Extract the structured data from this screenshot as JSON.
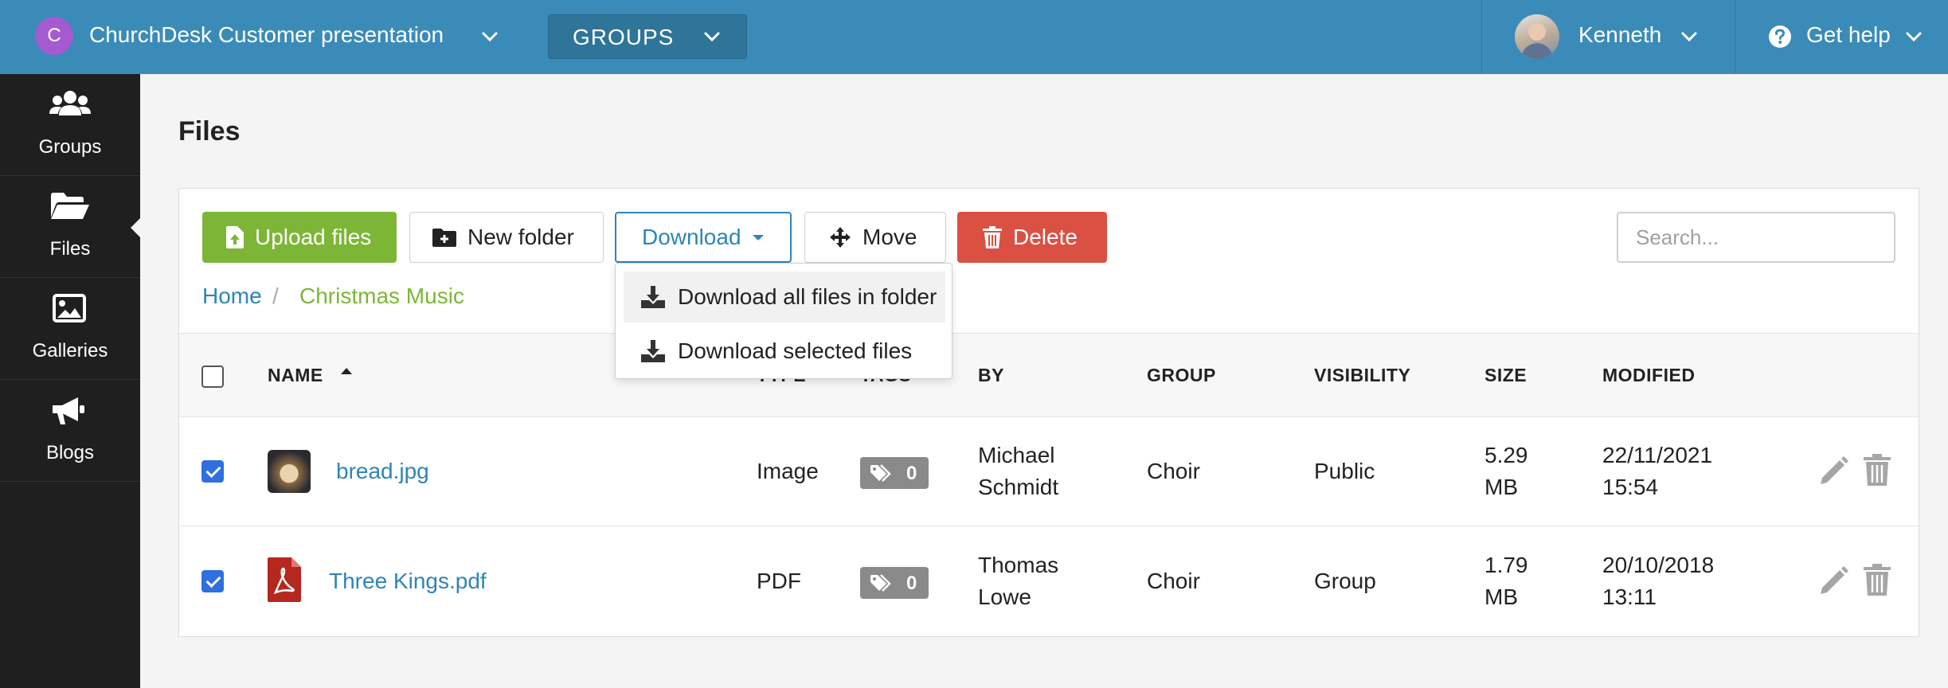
{
  "topbar": {
    "org_initial": "C",
    "org_name": "ChurchDesk Customer presentation",
    "groups_label": "GROUPS",
    "user_name": "Kenneth",
    "help_label": "Get help",
    "color": "#3b8bb8"
  },
  "sidebar": {
    "items": [
      {
        "label": "Groups",
        "icon": "users-icon"
      },
      {
        "label": "Files",
        "icon": "folder-open-icon"
      },
      {
        "label": "Galleries",
        "icon": "image-icon"
      },
      {
        "label": "Blogs",
        "icon": "megaphone-icon"
      }
    ],
    "active": "Files"
  },
  "page": {
    "title": "Files"
  },
  "toolbar": {
    "upload_label": "Upload files",
    "new_folder_label": "New folder",
    "download_label": "Download",
    "move_label": "Move",
    "delete_label": "Delete",
    "search_placeholder": "Search..."
  },
  "download_menu": {
    "items": [
      "Download all files in folder",
      "Download selected files"
    ]
  },
  "breadcrumb": {
    "home": "Home",
    "separator": "/",
    "current": "Christmas Music"
  },
  "table": {
    "headers": {
      "name": "NAME",
      "type": "TYPE",
      "tags": "TAGS",
      "by": "BY",
      "group": "GROUP",
      "visibility": "VISIBILITY",
      "size": "SIZE",
      "modified": "MODIFIED"
    },
    "rows": [
      {
        "checked": true,
        "icon": "image-thumbnail",
        "name": "bread.jpg",
        "type": "Image",
        "tags": "0",
        "by_first": "Michael",
        "by_last": "Schmidt",
        "group": "Choir",
        "visibility": "Public",
        "size_value": "5.29",
        "size_unit": "MB",
        "modified_date": "22/11/2021",
        "modified_time": "15:54"
      },
      {
        "checked": true,
        "icon": "pdf-icon",
        "name": "Three Kings.pdf",
        "type": "PDF",
        "tags": "0",
        "by_first": "Thomas",
        "by_last": "Lowe",
        "group": "Choir",
        "visibility": "Group",
        "size_value": "1.79",
        "size_unit": "MB",
        "modified_date": "20/10/2018",
        "modified_time": "13:11"
      }
    ]
  }
}
